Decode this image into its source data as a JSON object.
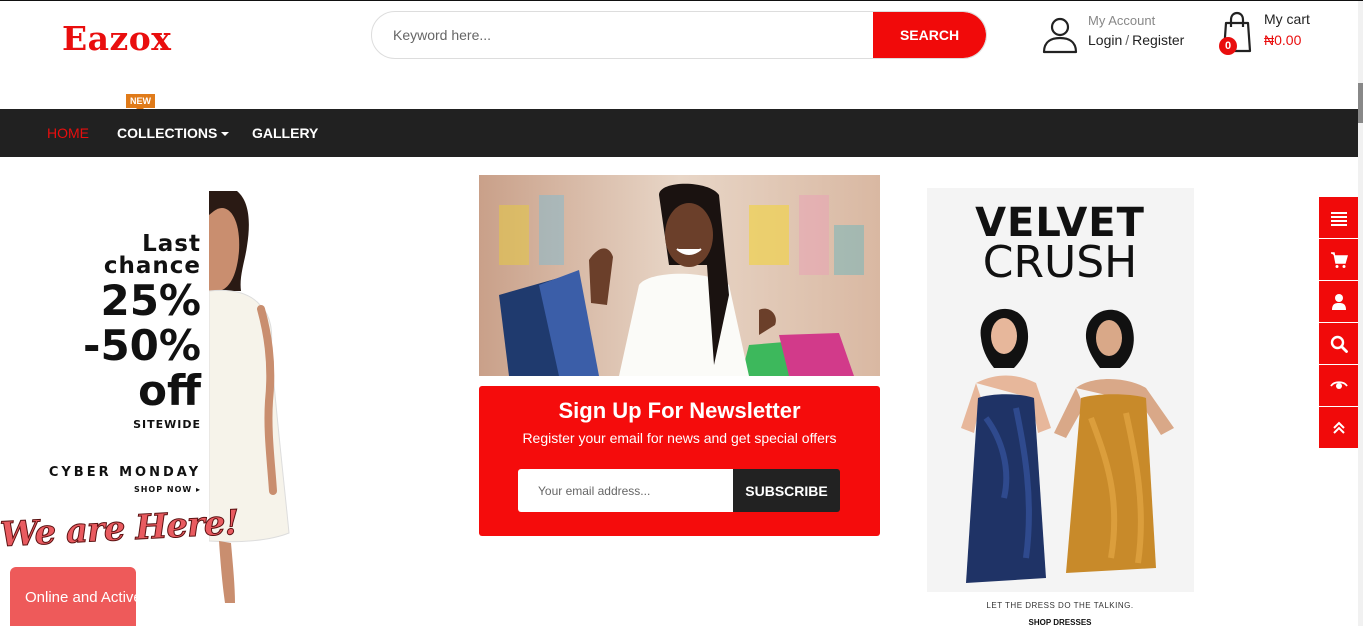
{
  "brand": {
    "logo_text": "Eazox",
    "accent": "#e90e0e",
    "dark": "#212121"
  },
  "header": {
    "search_placeholder": "Keyword here...",
    "search_button": "SEARCH",
    "account_label": "My Account",
    "login_label": "Login",
    "separator": "/",
    "register_label": "Register",
    "cart_label": "My cart",
    "cart_count": "0",
    "cart_total": "₦0.00"
  },
  "nav": {
    "items": [
      {
        "label": "HOME",
        "active": true
      },
      {
        "label": "COLLECTIONS",
        "has_dropdown": true,
        "badge": "NEW"
      },
      {
        "label": "GALLERY"
      }
    ]
  },
  "left_banner": {
    "line1": "Last",
    "line2": "chance",
    "pct1": "25%",
    "pct2": "-50%",
    "off": "off",
    "sitewide": "SITEWIDE",
    "cyber": "CYBER MONDAY",
    "shop_now": "SHOP NOW ▸",
    "we_are_here": "We are Here!"
  },
  "chat": {
    "label": "Online and Active"
  },
  "newsletter": {
    "title": "Sign Up For Newsletter",
    "subtitle": "Register your email for news and get special offers",
    "email_placeholder": "Your email address...",
    "button": "SUBSCRIBE"
  },
  "right_banner": {
    "title1": "VELVET",
    "title2": "CRUSH",
    "tagline": "LET THE DRESS DO THE TALKING.",
    "shop": "SHOP DRESSES"
  },
  "side_toolbar": [
    "menu-icon",
    "cart-icon",
    "user-icon",
    "search-icon",
    "eye-icon",
    "scroll-top-icon"
  ]
}
